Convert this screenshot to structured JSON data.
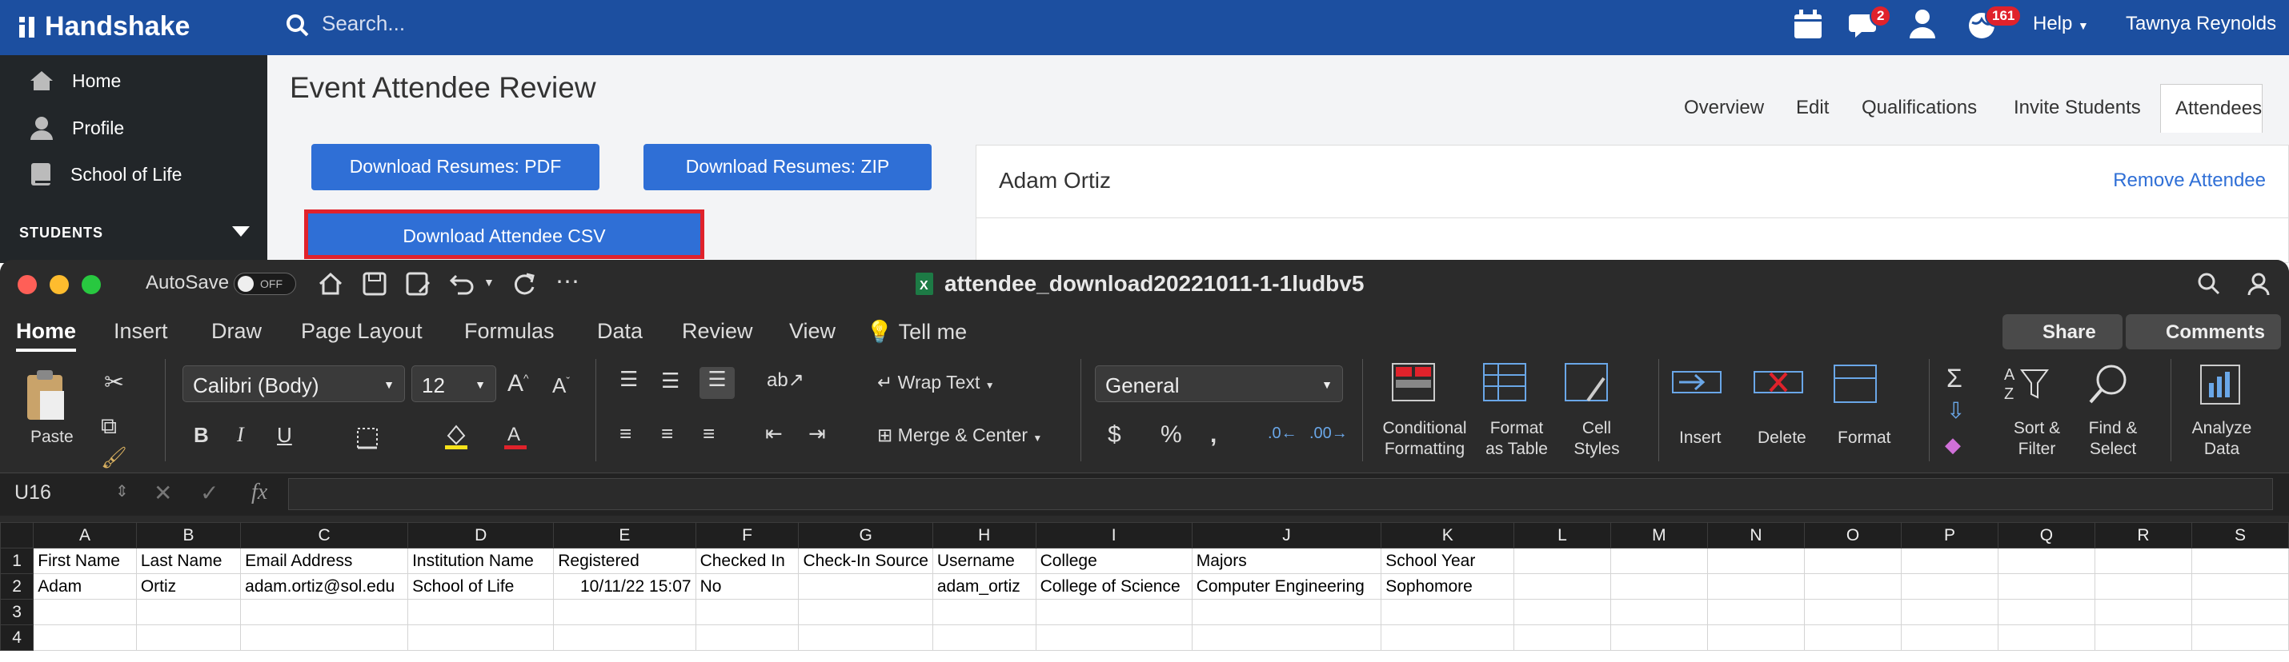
{
  "handshake": {
    "logo": "Handshake",
    "search_placeholder": "Search...",
    "badges": {
      "chat": "2",
      "globe": "161"
    },
    "help_label": "Help",
    "user_name": "Tawnya Reynolds",
    "sidebar": {
      "items": [
        {
          "label": "Home"
        },
        {
          "label": "Profile"
        },
        {
          "label": "School of Life"
        }
      ],
      "section_header": "STUDENTS"
    },
    "page_title": "Event Attendee Review",
    "tabs": [
      {
        "label": "Overview"
      },
      {
        "label": "Edit"
      },
      {
        "label": "Qualifications"
      },
      {
        "label": "Invite Students"
      },
      {
        "label": "Attendees"
      }
    ],
    "buttons": {
      "resumes_pdf": "Download Resumes: PDF",
      "resumes_zip": "Download Resumes: ZIP",
      "attendee_csv": "Download Attendee CSV"
    },
    "attendee": {
      "name": "Adam Ortiz",
      "remove_label": "Remove Attendee"
    }
  },
  "excel": {
    "autosave_label": "AutoSave",
    "autosave_state": "OFF",
    "file_title": "attendee_download20221011-1-1ludbv5",
    "menu": [
      "Home",
      "Insert",
      "Draw",
      "Page Layout",
      "Formulas",
      "Data",
      "Review",
      "View",
      "Tell me"
    ],
    "share_label": "Share",
    "comments_label": "Comments",
    "ribbon": {
      "paste": "Paste",
      "font_name": "Calibri (Body)",
      "font_size": "12",
      "wrap_text": "Wrap Text",
      "merge_center": "Merge & Center",
      "number_format": "General",
      "conditional_formatting_1": "Conditional",
      "conditional_formatting_2": "Formatting",
      "format_table_1": "Format",
      "format_table_2": "as Table",
      "cell_styles_1": "Cell",
      "cell_styles_2": "Styles",
      "insert": "Insert",
      "delete": "Delete",
      "format": "Format",
      "sort_filter_1": "Sort &",
      "sort_filter_2": "Filter",
      "find_select_1": "Find &",
      "find_select_2": "Select",
      "analyze_data_1": "Analyze",
      "analyze_data_2": "Data"
    },
    "name_box": "U16",
    "fx_label": "fx",
    "columns": [
      "A",
      "B",
      "C",
      "D",
      "E",
      "F",
      "G",
      "H",
      "I",
      "J",
      "K",
      "L",
      "M",
      "N",
      "O",
      "P",
      "Q",
      "R",
      "S"
    ],
    "rows": [
      {
        "num": "1",
        "cells": [
          "First Name",
          "Last Name",
          "Email Address",
          "Institution Name",
          "Registered",
          "Checked In",
          "Check-In Source",
          "Username",
          "College",
          "Majors",
          "School Year",
          "",
          "",
          "",
          "",
          "",
          "",
          "",
          ""
        ]
      },
      {
        "num": "2",
        "cells": [
          "Adam",
          "Ortiz",
          "adam.ortiz@sol.edu",
          "School of Life",
          "10/11/22 15:07",
          "No",
          "",
          "adam_ortiz",
          "College of Science",
          "Computer Engineering",
          "Sophomore",
          "",
          "",
          "",
          "",
          "",
          "",
          "",
          ""
        ]
      },
      {
        "num": "3",
        "cells": [
          "",
          "",
          "",
          "",
          "",
          "",
          "",
          "",
          "",
          "",
          "",
          "",
          "",
          "",
          "",
          "",
          "",
          "",
          ""
        ]
      },
      {
        "num": "4",
        "cells": [
          "",
          "",
          "",
          "",
          "",
          "",
          "",
          "",
          "",
          "",
          "",
          "",
          "",
          "",
          "",
          "",
          "",
          "",
          ""
        ]
      }
    ]
  }
}
